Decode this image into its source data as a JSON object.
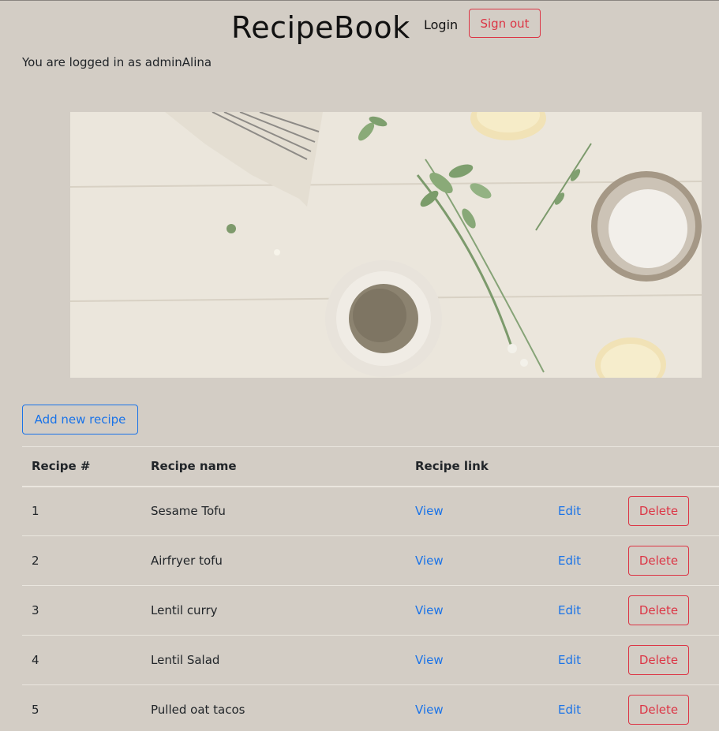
{
  "header": {
    "brand": "RecipeBook",
    "login_label": "Login",
    "signout_label": "Sign out"
  },
  "status": {
    "logged_in_text": "You are logged in as adminAlina"
  },
  "actions": {
    "add_label": "Add new recipe"
  },
  "table": {
    "headers": [
      "Recipe #",
      "Recipe name",
      "Recipe link"
    ],
    "rows": [
      {
        "num": "1",
        "name": "Sesame Tofu",
        "view": "View",
        "edit": "Edit",
        "delete": "Delete"
      },
      {
        "num": "2",
        "name": "Airfryer tofu",
        "view": "View",
        "edit": "Edit",
        "delete": "Delete"
      },
      {
        "num": "3",
        "name": "Lentil curry",
        "view": "View",
        "edit": "Edit",
        "delete": "Delete"
      },
      {
        "num": "4",
        "name": "Lentil Salad",
        "view": "View",
        "edit": "Edit",
        "delete": "Delete"
      },
      {
        "num": "5",
        "name": "Pulled oat tacos",
        "view": "View",
        "edit": "Edit",
        "delete": "Delete"
      }
    ]
  },
  "colors": {
    "background": "#d3cdc5",
    "primary": "#1a73e8",
    "danger": "#dc3545"
  }
}
